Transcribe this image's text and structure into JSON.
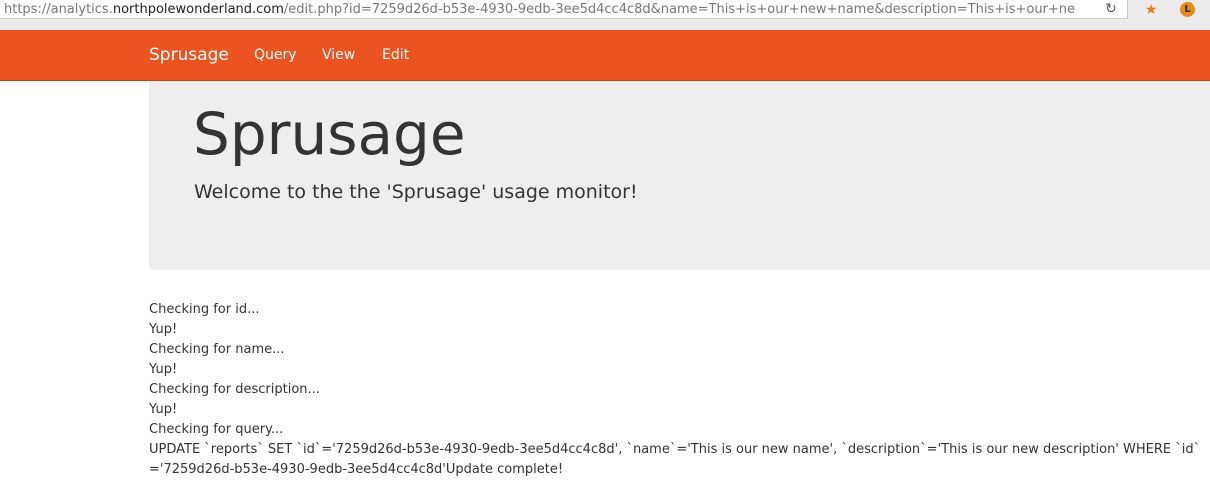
{
  "browser": {
    "url_prefix": "https://analytics.",
    "url_host": "northpolewonderland.com",
    "url_path": "/edit.php?id=7259d26d-b53e-4930-9edb-3ee5d4cc4c8d&name=This+is+our+new+name&description=This+is+our+ne",
    "reload_icon": "reload-icon",
    "extension_icons": [
      "bookmark-star-icon",
      "extension-l-icon"
    ],
    "extension_badge": "L"
  },
  "navbar": {
    "brand": "Sprusage",
    "items": [
      "Query",
      "View",
      "Edit"
    ],
    "color": "#e95420"
  },
  "jumbotron": {
    "title": "Sprusage",
    "subtitle": "Welcome to the the 'Sprusage' usage monitor!"
  },
  "output": {
    "lines": [
      "Checking for id...",
      "Yup!",
      "Checking for name...",
      "Yup!",
      "Checking for description...",
      "Yup!",
      "Checking for query...",
      "UPDATE `reports` SET `id`='7259d26d-b53e-4930-9edb-3ee5d4cc4c8d', `name`='This is our new name', `description`='This is our new description' WHERE `id`='7259d26d-b53e-4930-9edb-3ee5d4cc4c8d'Update complete!"
    ]
  }
}
